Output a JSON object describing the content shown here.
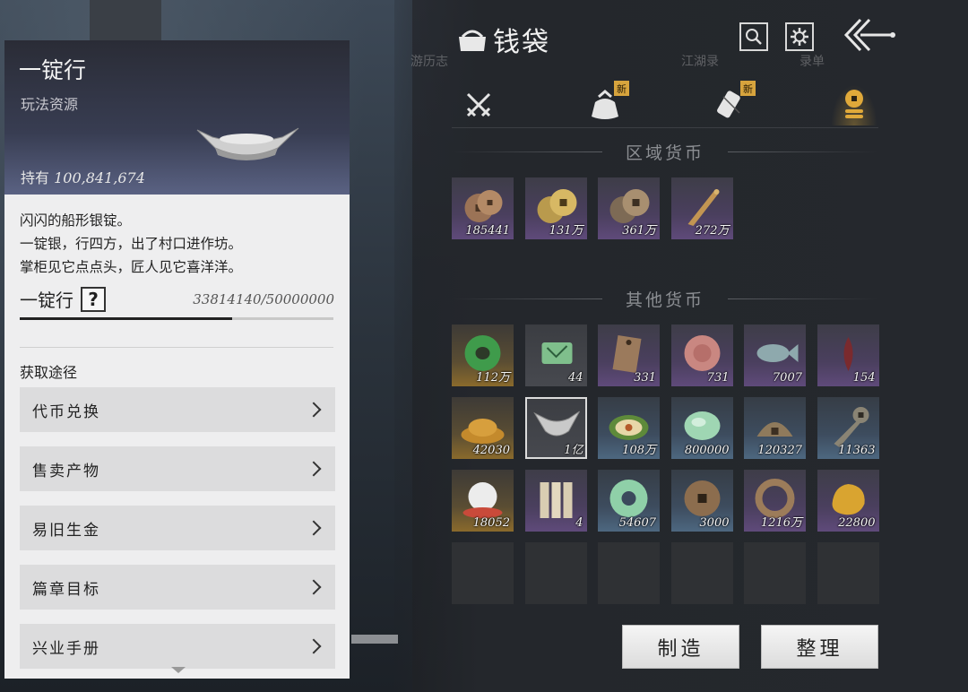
{
  "background": {
    "faint_tabs": [
      "游历志",
      "",
      "",
      "",
      "",
      "江湖录",
      "",
      "录单"
    ]
  },
  "detail": {
    "title": "一锭行",
    "subtitle": "玩法资源",
    "held_label": "持有",
    "held_value": "100,841,674",
    "description": [
      "闪闪的船形银锭。",
      "一锭银，行四方，出了村口进作坊。",
      "掌柜见它点点头，匠人见它喜洋洋。"
    ],
    "progress_label": "一锭行",
    "help_icon": "?",
    "progress_text": "33814140/50000000",
    "progress_fraction": 0.676,
    "source_title": "获取途径",
    "sources": [
      "代币兑换",
      "售卖产物",
      "易旧生金",
      "篇章目标",
      "兴业手册"
    ]
  },
  "header": {
    "title": "钱袋",
    "search_icon": "search-icon",
    "settings_icon": "gear-icon",
    "back_icon": "back-arrow-icon"
  },
  "tabs": [
    {
      "icon": "crossed-swords-icon",
      "badge": ""
    },
    {
      "icon": "pouch-icon",
      "badge": "新"
    },
    {
      "icon": "scroll-icon",
      "badge": "新"
    },
    {
      "icon": "coin-stack-icon",
      "badge": ""
    }
  ],
  "sections": {
    "regional_title": "区域货币",
    "other_title": "其他货币"
  },
  "regional_items": [
    {
      "icon": "bronze-coins-icon",
      "count": "185441",
      "rarity": "purple"
    },
    {
      "icon": "gold-coins-icon",
      "count": "131万",
      "rarity": "purple"
    },
    {
      "icon": "copper-coins-icon",
      "count": "361万",
      "rarity": "purple"
    },
    {
      "icon": "blade-token-icon",
      "count": "272万",
      "rarity": "purple"
    }
  ],
  "other_items": [
    {
      "icon": "jade-ring-icon",
      "count": "112万",
      "rarity": "gold"
    },
    {
      "icon": "jade-map-icon",
      "count": "44",
      "rarity": "grey"
    },
    {
      "icon": "bronze-tag-icon",
      "count": "331",
      "rarity": "purple"
    },
    {
      "icon": "red-jade-icon",
      "count": "731",
      "rarity": "purple"
    },
    {
      "icon": "fish-icon",
      "count": "7007",
      "rarity": "purple"
    },
    {
      "icon": "red-leaf-icon",
      "count": "154",
      "rarity": "purple"
    },
    {
      "icon": "grain-pile-icon",
      "count": "42030",
      "rarity": "gold"
    },
    {
      "icon": "silver-ingot-icon",
      "count": "1亿",
      "rarity": "grey",
      "selected": true
    },
    {
      "icon": "melon-icon",
      "count": "108万",
      "rarity": "blue"
    },
    {
      "icon": "jade-stone-icon",
      "count": "800000",
      "rarity": "blue"
    },
    {
      "icon": "bronze-half-coin-icon",
      "count": "120327",
      "rarity": "blue"
    },
    {
      "icon": "ancient-spade-coin-icon",
      "count": "11363",
      "rarity": "blue"
    },
    {
      "icon": "pearl-icon",
      "count": "18052",
      "rarity": "gold"
    },
    {
      "icon": "bamboo-slips-icon",
      "count": "4",
      "rarity": "purple"
    },
    {
      "icon": "jade-bi-icon",
      "count": "54607",
      "rarity": "blue"
    },
    {
      "icon": "square-hole-coin-icon",
      "count": "3000",
      "rarity": "blue"
    },
    {
      "icon": "coin-string-icon",
      "count": "1216万",
      "rarity": "purple"
    },
    {
      "icon": "gold-nugget-icon",
      "count": "22800",
      "rarity": "purple"
    }
  ],
  "buttons": {
    "craft": "制造",
    "sort": "整理"
  },
  "colors": {
    "accent_gold": "#d7a43d",
    "panel_bg": "#eeeeef",
    "dark_bg": "#24272c"
  }
}
